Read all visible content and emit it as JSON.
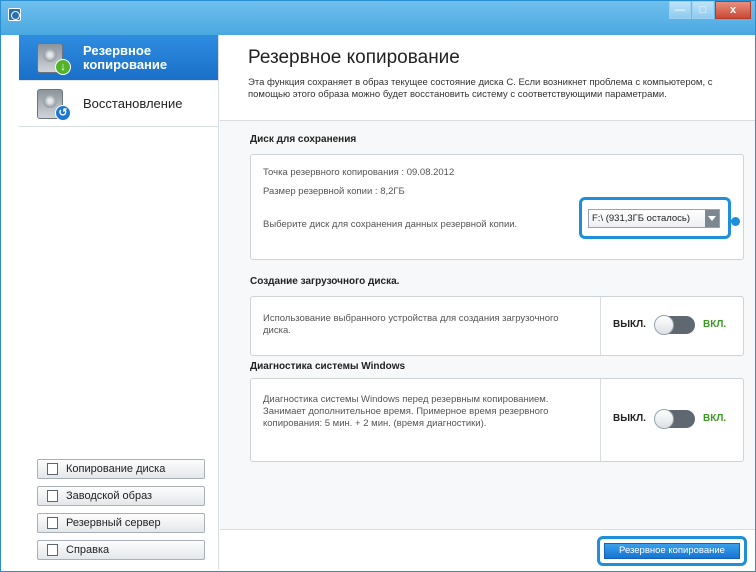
{
  "window": {
    "controls": {
      "minimize": "—",
      "maximize": "□",
      "close": "x"
    }
  },
  "sidebar": {
    "items": [
      {
        "label": "Резервное копирование",
        "active": true,
        "icon": "drive-backup-icon"
      },
      {
        "label": "Восстановление",
        "active": false,
        "icon": "drive-restore-icon"
      }
    ],
    "buttons": [
      {
        "label": "Копирование диска",
        "icon": "disk-copy-icon"
      },
      {
        "label": "Заводской образ",
        "icon": "factory-image-icon"
      },
      {
        "label": "Резервный сервер",
        "icon": "backup-server-icon"
      },
      {
        "label": "Справка",
        "icon": "help-icon"
      }
    ]
  },
  "header": {
    "title": "Резервное копирование",
    "description": "Эта функция сохраняет в образ текущее состояние диска C. Если возникнет проблема с компьютером, с помощью этого образа можно будет восстановить систему с соответствующими параметрами."
  },
  "disk_section": {
    "title": "Диск для сохранения",
    "backup_point": "Точка резервного копирования : 09.08.2012",
    "backup_size": "Размер резервной копии : 8,2ГБ",
    "select_prompt": "Выберите диск для сохранения данных резервной копии.",
    "selected_drive": "F:\\ (931,3ГБ осталось)"
  },
  "boot_section": {
    "title": "Создание загрузочного диска.",
    "text": "Использование выбранного устройства для создания загрузочного диска.",
    "off_label": "ВЫКЛ.",
    "on_label": "ВКЛ.",
    "enabled": false
  },
  "diag_section": {
    "title": "Диагностика системы Windows",
    "text": "Диагностика системы Windows перед резервным копированием. Занимает дополнительное время. Примерное время резервного копирования: 5 мин. + 2 мин. (время диагностики).",
    "off_label": "ВЫКЛ.",
    "on_label": "ВКЛ.",
    "enabled": false
  },
  "footer": {
    "primary_button": "Резервное копирование"
  },
  "colors": {
    "accent": "#1e8fd8",
    "on_green": "#3c9a24"
  }
}
